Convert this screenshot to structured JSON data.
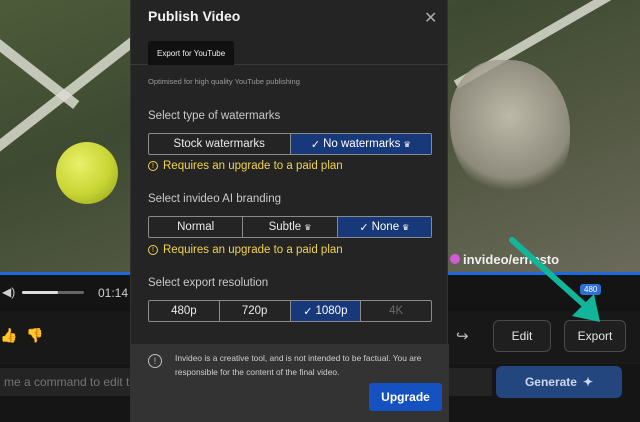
{
  "background": {
    "watermark_text": "invideo/ernesto",
    "time": "01:14 /",
    "resolution_badge": "480",
    "edit_label": "Edit",
    "export_label": "Export",
    "command_placeholder": "me a command to edit the",
    "generate_label": "Generate"
  },
  "modal": {
    "title": "Publish Video",
    "close_icon": "close-icon",
    "tab_label": "Export for YouTube",
    "subtitle": "Optimised for high quality YouTube publishing",
    "watermarks": {
      "label": "Select type of watermarks",
      "options": [
        "Stock watermarks",
        "No watermarks"
      ],
      "selected": "No watermarks",
      "warning": "Requires an upgrade to a paid plan"
    },
    "branding": {
      "label": "Select invideo AI branding",
      "options": [
        "Normal",
        "Subtle",
        "None"
      ],
      "selected": "None",
      "warning": "Requires an upgrade to a paid plan"
    },
    "resolution": {
      "label": "Select export resolution",
      "options": [
        "480p",
        "720p",
        "1080p",
        "4K"
      ],
      "selected": "1080p",
      "disabled": [
        "4K"
      ]
    },
    "disclaimer": "Invideo is a creative tool, and is not intended to be factual. You are responsible for the content of the final video.",
    "upgrade_label": "Upgrade"
  },
  "colors": {
    "accent": "#1651c2",
    "selected_segment": "#17397a",
    "warning": "#f2d34c",
    "arrow": "#12b59a"
  }
}
